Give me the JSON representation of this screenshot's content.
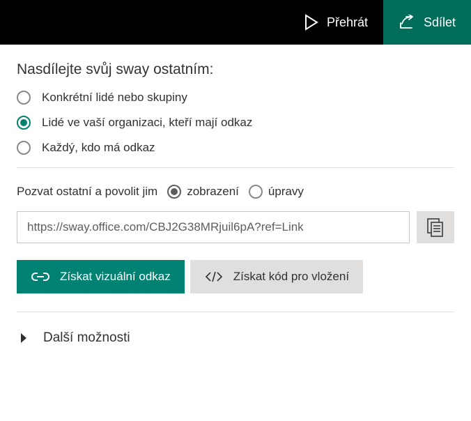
{
  "header": {
    "play_label": "Přehrát",
    "share_label": "Sdílet"
  },
  "share": {
    "title": "Nasdílejte svůj sway ostatním:",
    "options": {
      "specific": "Konkrétní lidé nebo skupiny",
      "org": "Lidé ve vaší organizaci, kteří mají odkaz",
      "anyone": "Každý, kdo má odkaz"
    }
  },
  "invite": {
    "label": "Pozvat ostatní a povolit jim",
    "view": "zobrazení",
    "edit": "úpravy"
  },
  "link": {
    "url": "https://sway.office.com/CBJ2G38MRjuil6pA?ref=Link"
  },
  "actions": {
    "visual_link": "Získat vizuální odkaz",
    "embed_code": "Získat kód pro vložení"
  },
  "more": {
    "label": "Další možnosti"
  }
}
